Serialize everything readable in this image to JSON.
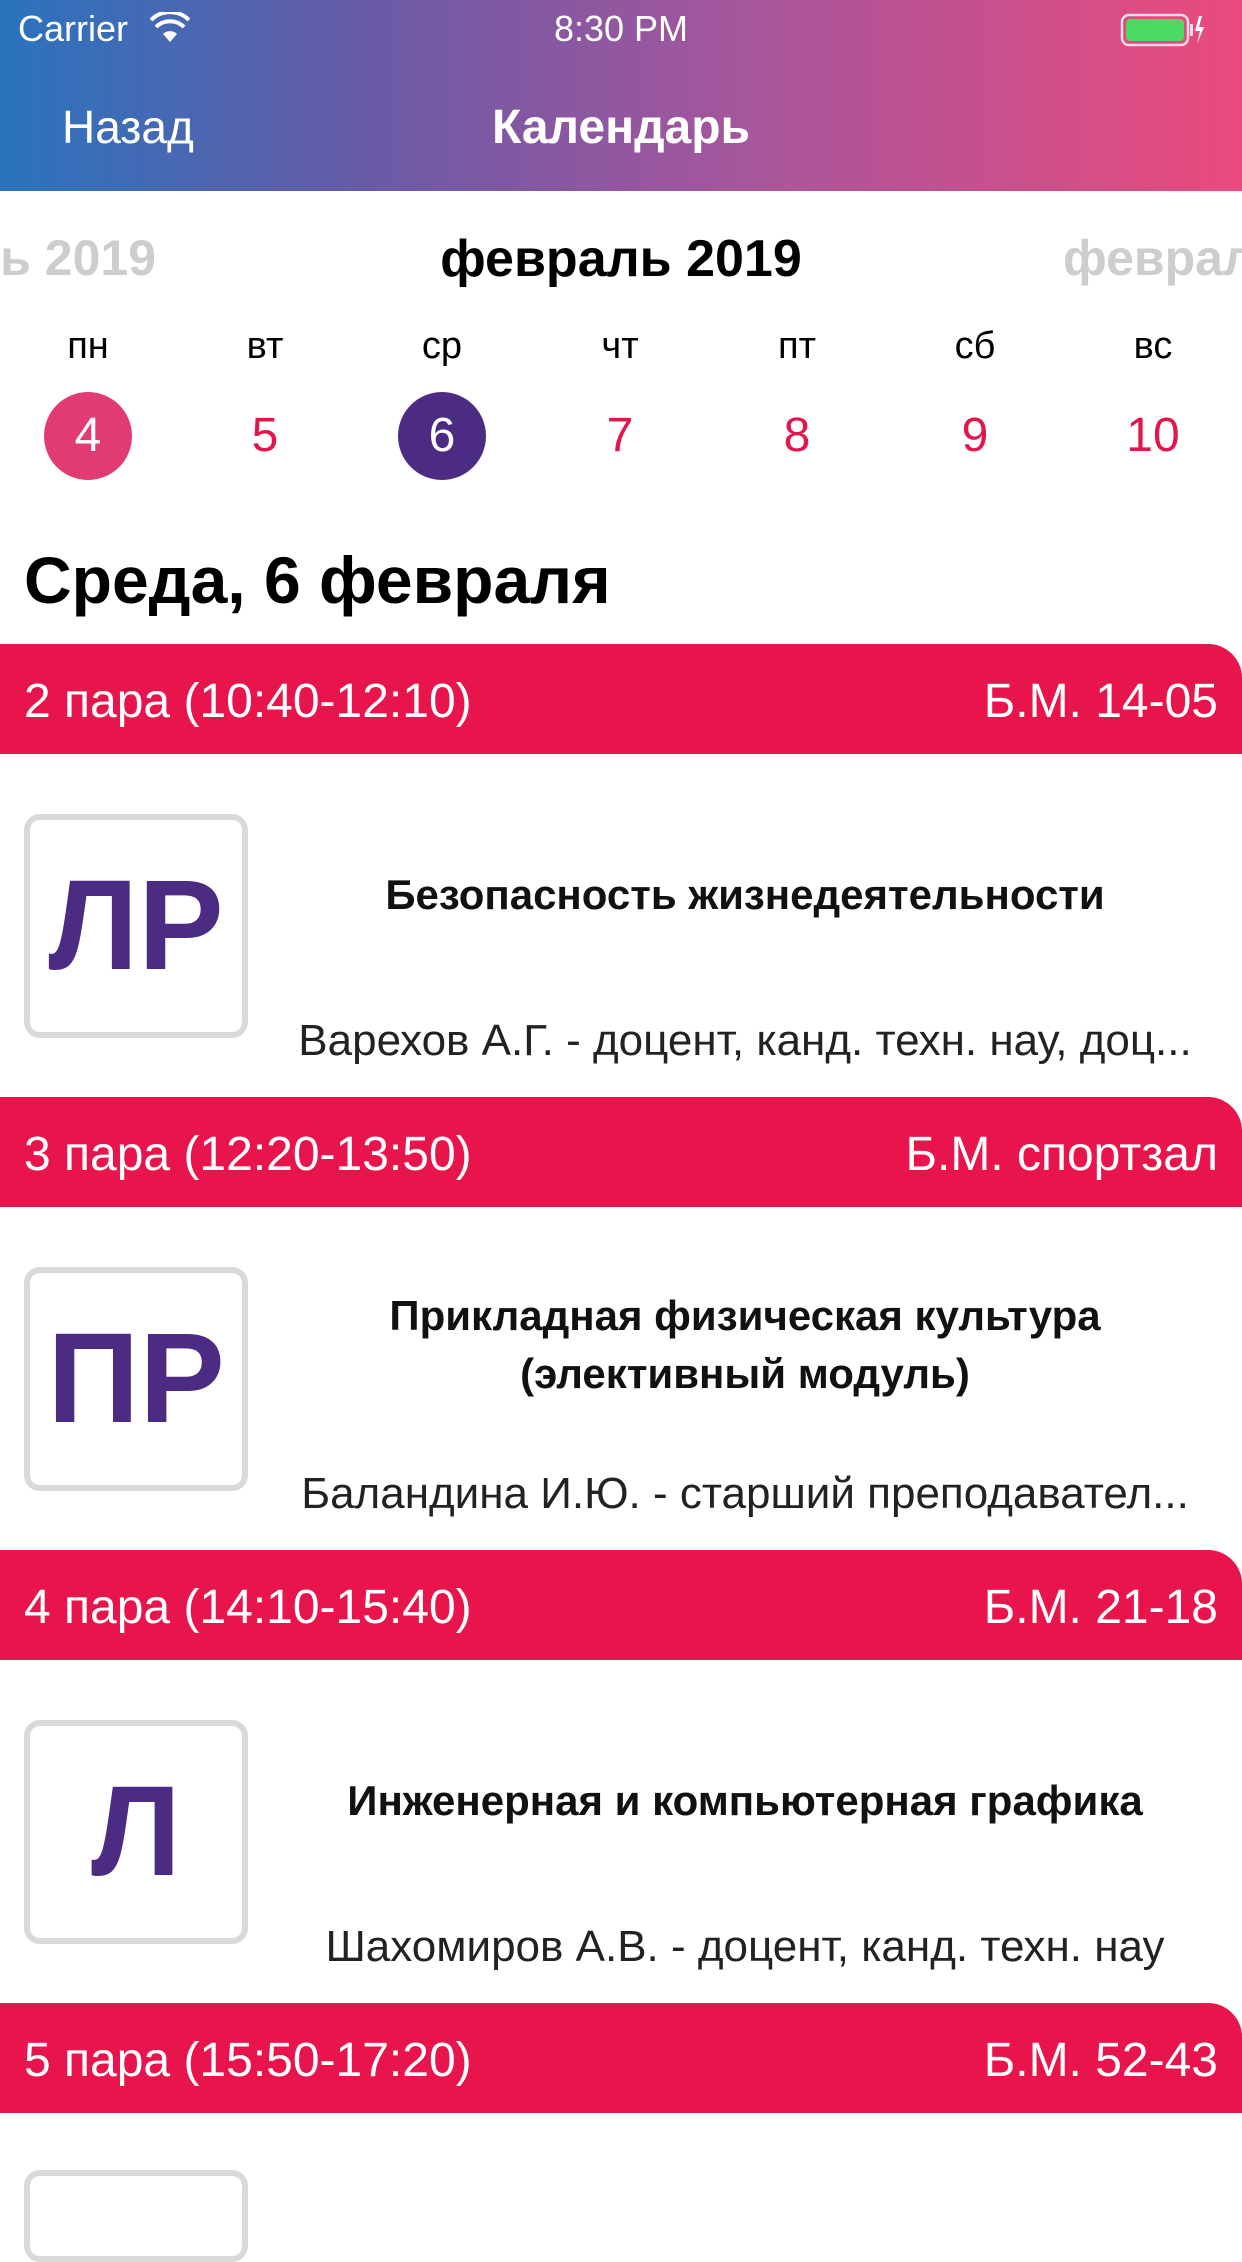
{
  "status_bar": {
    "carrier": "Carrier",
    "time": "8:30 PM"
  },
  "nav": {
    "back_label": "Назад",
    "title": "Календарь"
  },
  "calendar": {
    "prev_month": "ь 2019",
    "current_month": "февраль 2019",
    "next_month": "феврал",
    "days": [
      {
        "weekday": "пн",
        "num": "4"
      },
      {
        "weekday": "вт",
        "num": "5"
      },
      {
        "weekday": "ср",
        "num": "6"
      },
      {
        "weekday": "чт",
        "num": "7"
      },
      {
        "weekday": "пт",
        "num": "8"
      },
      {
        "weekday": "сб",
        "num": "9"
      },
      {
        "weekday": "вс",
        "num": "10"
      }
    ]
  },
  "day_heading": "Среда, 6 февраля",
  "schedule": [
    {
      "time": "2 пара (10:40-12:10)",
      "room": "Б.М. 14-05",
      "type": "ЛР",
      "subject_lines": [
        "Безопасность жизнедеятельности"
      ],
      "teacher": "Варехов А.Г. - доцент, канд. техн. нау, доц..."
    },
    {
      "time": "3 пара (12:20-13:50)",
      "room": "Б.М. спортзал",
      "type": "ПР",
      "subject_lines": [
        "Прикладная физическая культура",
        "(элективный модуль)"
      ],
      "teacher": "Баландина И.Ю. - старший преподавател..."
    },
    {
      "time": "4 пара (14:10-15:40)",
      "room": "Б.М. 21-18",
      "type": "Л",
      "subject_lines": [
        "Инженерная и компьютерная графика"
      ],
      "teacher": "Шахомиров А.В. - доцент, канд. техн. нау"
    },
    {
      "time": "5 пара (15:50-17:20)",
      "room": "Б.М. 52-43"
    }
  ],
  "colors": {
    "accent": "#e8144c",
    "selected_day": "#4b2c82",
    "today": "#e23b73"
  }
}
